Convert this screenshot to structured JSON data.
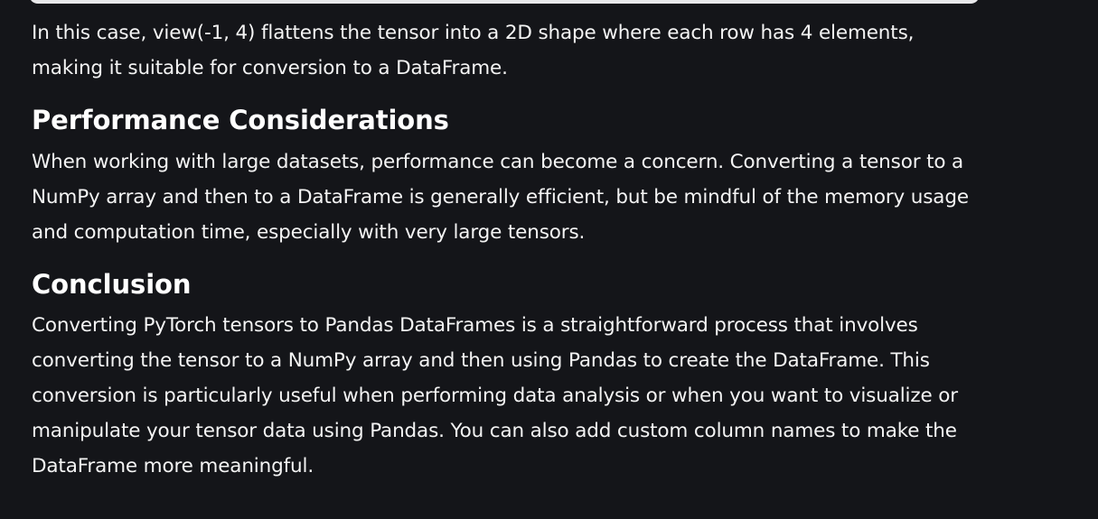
{
  "article": {
    "paragraph_1": "In this case, view(-1, 4) flattens the tensor into a 2D shape where each row has 4 elements, making it suitable for conversion to a DataFrame.",
    "heading_performance": "Performance Considerations",
    "paragraph_2": "When working with large datasets, performance can become a concern. Converting a tensor to a NumPy array and then to a DataFrame is generally efficient, but be mindful of the memory usage and computation time, especially with very large tensors.",
    "heading_conclusion": "Conclusion",
    "paragraph_3": "Converting PyTorch tensors to Pandas DataFrames is a straightforward process that involves converting the tensor to a NumPy array and then using Pandas to create the DataFrame. This conversion is particularly useful when performing data analysis or when you want to visualize or manipulate your tensor data using Pandas. You can also add custom column names to make the DataFrame more meaningful."
  },
  "colors": {
    "background": "#141519",
    "text": "#f4f4f4",
    "code_block": "#e8e8ea"
  }
}
